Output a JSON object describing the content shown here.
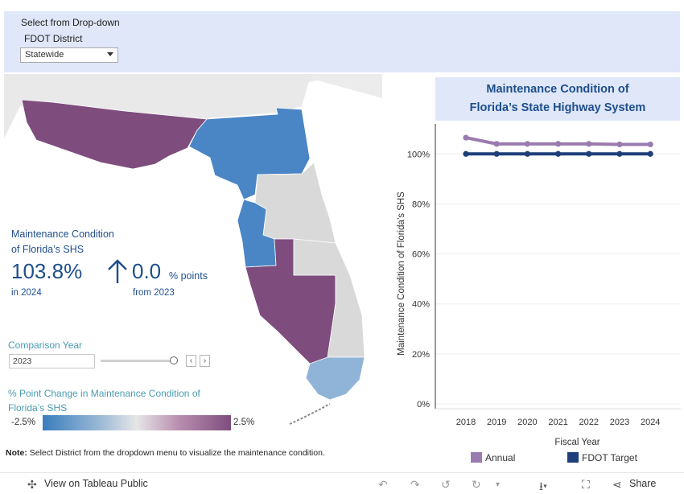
{
  "filter": {
    "title": "Select from Drop-down",
    "label": "FDOT District",
    "selected": "Statewide"
  },
  "kpi": {
    "title_line1": "Maintenance Condition",
    "title_line2": "of Florida’s SHS",
    "value": "103.8%",
    "in_year": "in 2024",
    "change": "0.0",
    "change_unit": "% points",
    "from_year": "from 2023",
    "direction": "up"
  },
  "comparison": {
    "title": "Comparison Year",
    "value": "2023",
    "prev_label": "‹",
    "next_label": "›"
  },
  "map_legend": {
    "title": "% Point Change in Maintenance Condition of Florida’s SHS",
    "min_label": "-2.5%",
    "max_label": "2.5%"
  },
  "note": {
    "bold": "Note:",
    "text": " Select District from the dropdown menu to visualize the maintenance condition."
  },
  "chart_data": {
    "type": "line",
    "title_line1": "Maintenance Condition of",
    "title_line2": "Florida’s State Highway System",
    "xlabel": "Fiscal Year",
    "ylabel": "Maintenance Condition of Florida’s SHS",
    "categories": [
      "2018",
      "2019",
      "2020",
      "2021",
      "2022",
      "2023",
      "2024"
    ],
    "ylim": [
      0,
      1.12
    ],
    "yticks": [
      0,
      0.2,
      0.4,
      0.6,
      0.8,
      1.0
    ],
    "ytick_labels": [
      "0%",
      "20%",
      "40%",
      "60%",
      "80%",
      "100%"
    ],
    "grid": true,
    "legend_position": "bottom",
    "series": [
      {
        "name": "Annual",
        "color": "#9a7bb0",
        "values": [
          1.065,
          1.04,
          1.04,
          1.04,
          1.04,
          1.038,
          1.038
        ]
      },
      {
        "name": "FDOT Target",
        "color": "#1f3f7a",
        "values": [
          1.0,
          1.0,
          1.0,
          1.0,
          1.0,
          1.0,
          1.0
        ]
      }
    ]
  },
  "colors": {
    "accent": "#1f4e8c",
    "teal": "#4a9bb0",
    "panel_bg": "#dfe7f8",
    "district_blue": "#4a86c5",
    "district_purple": "#7e4d7e",
    "district_lightblue": "#8fb4d8",
    "district_gray": "#d9d9d9"
  },
  "footer": {
    "view_label": "View on Tableau Public",
    "share_label": "Share"
  }
}
